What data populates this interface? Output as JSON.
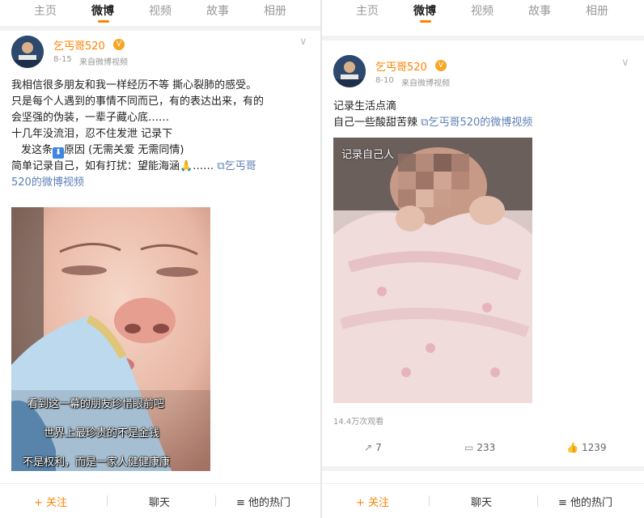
{
  "tabs": [
    "主页",
    "微博",
    "视频",
    "故事",
    "相册"
  ],
  "left_post": {
    "username": "乞丐哥520",
    "date": "8-15",
    "source": "来自微博视频",
    "lines": [
      "我相信很多朋友和我一样经历不等 撕心裂肺的感受。",
      "只是每个人遇到的事情不同而已，有的表达出来，有的",
      "会坚强的伪装，一辈子藏心底……",
      "十几年没流泪，忍不住发泄 记录下"
    ],
    "line5_pre": "发这条",
    "line5_post": "原因 (无需关爱 无需同情)",
    "line6": "简单记录自己，如有打扰：望能海涵🙏……",
    "video_link_a": "⧉乞丐哥",
    "video_link_b": "520的微博视频",
    "subtitles": [
      "看到这一幕的朋友珍惜眼前吧",
      "世界上最珍贵的不是金钱",
      "不是权利，而是一家人健健康康"
    ]
  },
  "right_post": {
    "username": "乞丐哥520",
    "date": "8-10",
    "source": "来自微博视频",
    "line1": "记录生活点滴",
    "line2": "自己一些酸甜苦辣",
    "video_link": "⧉乞丐哥520的微博视频",
    "video_caption": "记录自己人",
    "views": "14.4万次观看",
    "reposts": "7",
    "comments": "233",
    "likes": "1239"
  },
  "bottom_bar": {
    "follow": "关注",
    "follow_icon": "+",
    "chat": "聊天",
    "hot": "他的热门",
    "hot_icon": "≡"
  },
  "colors": {
    "accent": "#ff8200",
    "link": "#5d7fb6"
  },
  "icons": {
    "repost": "repost-icon",
    "comment": "comment-icon",
    "like": "like-icon",
    "vip": "vip-badge-icon",
    "arrow": "down-arrow-icon"
  }
}
